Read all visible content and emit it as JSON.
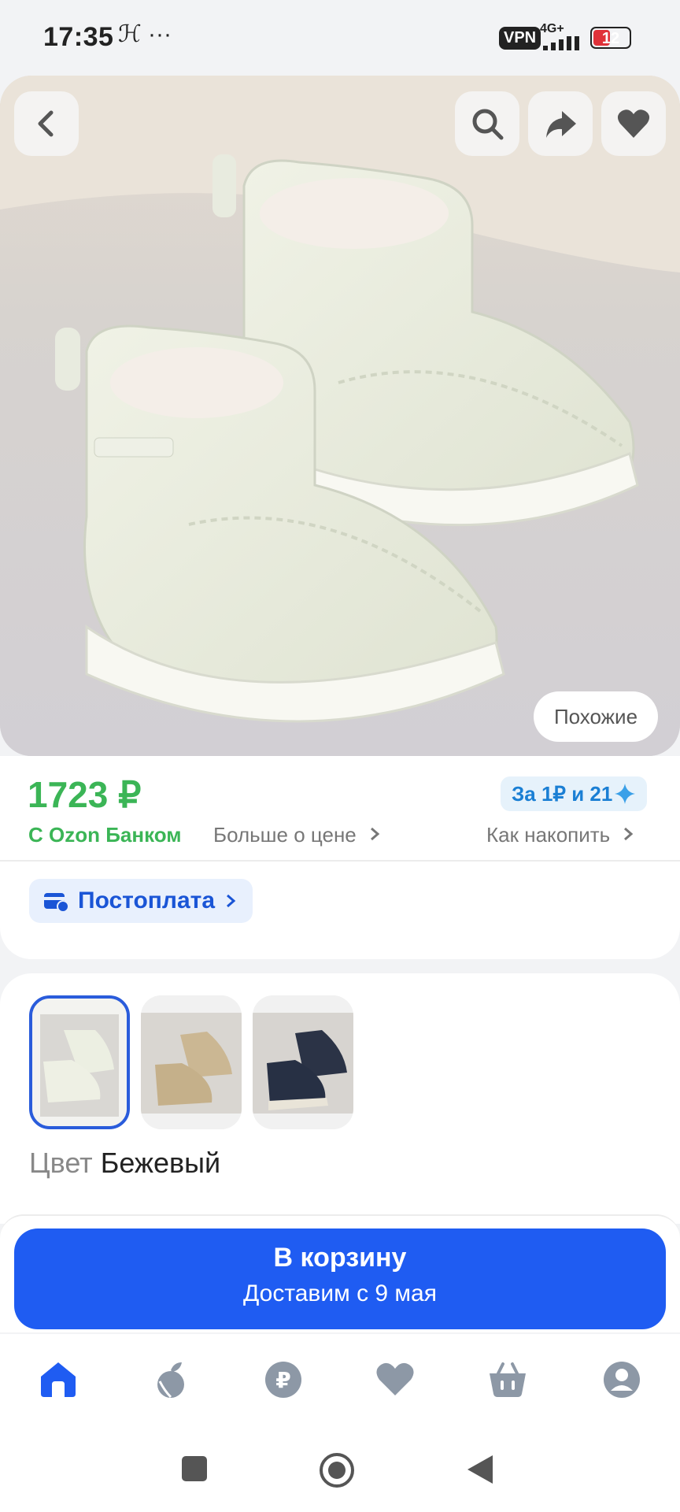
{
  "status_bar": {
    "time": "17:35",
    "extra": "ℋ ···",
    "vpn": "VPN",
    "network": "4G+",
    "battery": "12",
    "battery_level": 0.12
  },
  "hero": {
    "similar_label": "Похожие",
    "colors": {
      "boot": "#ecefe2",
      "fur": "#f2ece6"
    }
  },
  "price_card": {
    "price": "1723 ₽",
    "bank_label": "С Ozon Банком",
    "more_label": "Больше о цене",
    "bonus_label": "За 1₽ и 21",
    "howto_label": "Как накопить",
    "postpay_label": "Постоплата"
  },
  "color_card": {
    "label": "Цвет",
    "value": "Бежевый",
    "variants": [
      {
        "color": "beige",
        "selected": true
      },
      {
        "color": "tan",
        "selected": false
      },
      {
        "color": "navy",
        "selected": false
      }
    ]
  },
  "cart": {
    "title": "В корзину",
    "subtitle": "Доставим с 9 мая"
  },
  "tabbar": {
    "items": [
      "home-icon",
      "fresh-icon",
      "ruble-icon",
      "favorites-icon",
      "cart-icon",
      "profile-icon"
    ],
    "active": "home-icon"
  },
  "colors": {
    "accent": "#1f5cf2",
    "price_green": "#3bb556",
    "tab_inactive": "#8d98a6"
  }
}
